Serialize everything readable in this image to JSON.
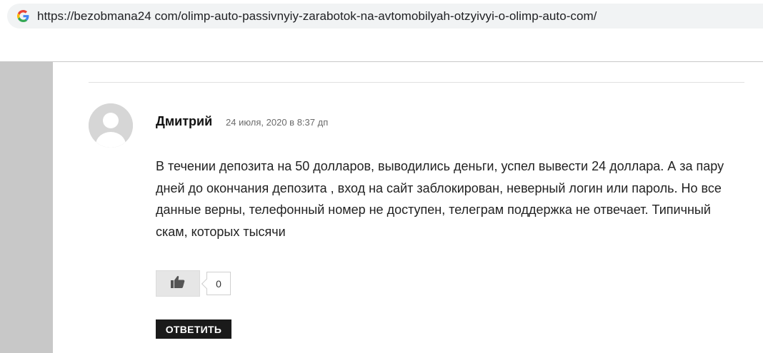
{
  "browser": {
    "url": "https://bezobmana24 com/olimp-auto-passivnyiy-zarabotok-na-avtomobilyah-otzyivyi-o-olimp-auto-com/",
    "favicon_icon": "google-g-icon"
  },
  "comment": {
    "author": "Дмитрий",
    "date": "24 июля, 2020 в 8:37 дп",
    "text": "В течении депозита на 50 долларов, выводились деньги, успел вывести 24 доллара. А за пару дней до окончания депозита , вход на сайт заблокирован, неверный логин или пароль. Но все данные верны, телефонный номер не доступен, телеграм поддержка не отвечает. Типичный скам, которых тысячи",
    "avatar_icon": "default-user-avatar-icon",
    "like_icon": "thumbs-up-icon",
    "like_count": "0",
    "reply_label": "ОТВЕТИТЬ"
  }
}
